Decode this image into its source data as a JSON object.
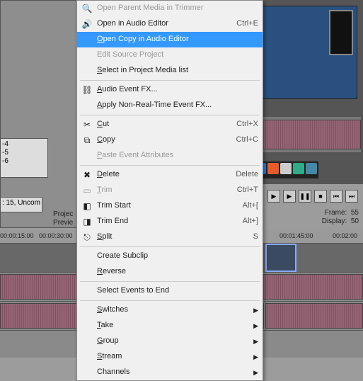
{
  "menu": {
    "items": [
      {
        "label": "Open Parent Media in Trimmer",
        "disabled": true,
        "icon": "🔍"
      },
      {
        "label": "Open in Audio Editor",
        "shortcut": "Ctrl+E",
        "icon": "🔊"
      },
      {
        "label": "Open Copy in Audio Editor",
        "hl": true,
        "underline": true
      },
      {
        "label": "Edit Source Project",
        "disabled": true
      },
      {
        "label": "Select in Project Media list",
        "underline": true
      },
      {
        "sep": true
      },
      {
        "label": "Audio Event FX...",
        "icon": "⛓",
        "underline": true
      },
      {
        "label": "Apply Non-Real-Time Event FX...",
        "underline": true
      },
      {
        "sep": true
      },
      {
        "label": "Cut",
        "shortcut": "Ctrl+X",
        "icon": "✂",
        "underline": true
      },
      {
        "label": "Copy",
        "shortcut": "Ctrl+C",
        "icon": "⧉",
        "underline": true
      },
      {
        "label": "Paste Event Attributes",
        "disabled": true,
        "underline": true
      },
      {
        "sep": true
      },
      {
        "label": "Delete",
        "shortcut": "Delete",
        "icon": "✖",
        "underline": true
      },
      {
        "label": "Trim",
        "shortcut": "Ctrl+T",
        "disabled": true,
        "icon": "▭",
        "underline": true
      },
      {
        "label": "Trim Start",
        "shortcut": "Alt+[",
        "icon": "◧"
      },
      {
        "label": "Trim End",
        "shortcut": "Alt+]",
        "icon": "◨"
      },
      {
        "label": "Split",
        "shortcut": "S",
        "icon": "⎋",
        "underline": true
      },
      {
        "sep": true
      },
      {
        "label": "Create Subclip"
      },
      {
        "label": "Reverse",
        "underline": true
      },
      {
        "sep": true
      },
      {
        "label": "Select Events to End"
      },
      {
        "sep": true
      },
      {
        "label": "Switches",
        "arrow": true,
        "underline": true
      },
      {
        "label": "Take",
        "arrow": true,
        "underline": true
      },
      {
        "label": "Group",
        "arrow": true,
        "underline": true
      },
      {
        "label": "Stream",
        "arrow": true,
        "underline": true
      },
      {
        "label": "Channels",
        "arrow": true
      }
    ]
  },
  "left": {
    "list": [
      "-4",
      "-5",
      "-6"
    ],
    "status": ": 15, Uncom"
  },
  "labels": {
    "a": "Projec",
    "b": "Previe"
  },
  "timeline": {
    "ticks": [
      "00:00:15:00",
      "00:00:30:00",
      "00:01:45:00",
      "00:02:00"
    ]
  },
  "info": {
    "frame": "Frame:",
    "frame_v": "55",
    "display": "Display:",
    "display_v": "50"
  }
}
